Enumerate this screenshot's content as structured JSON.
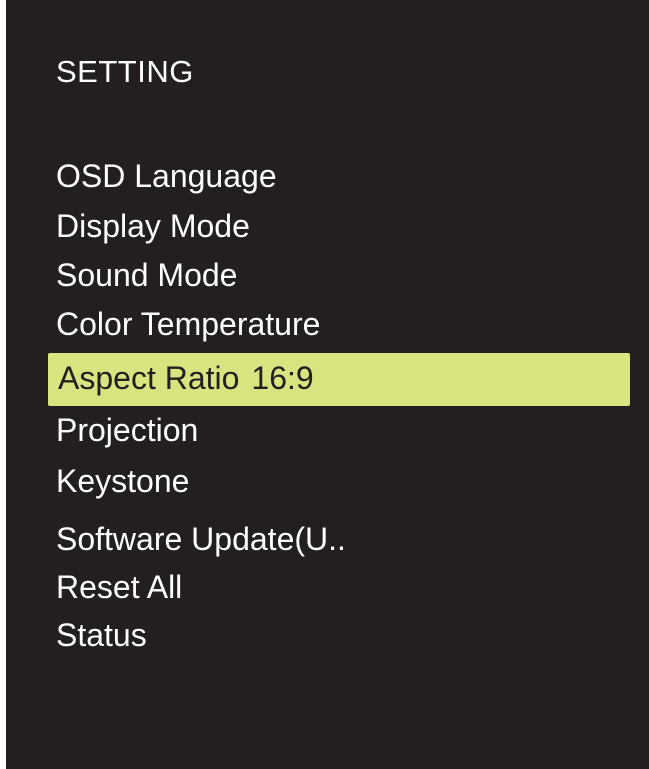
{
  "osd": {
    "title": "SETTING",
    "items": [
      {
        "label": "OSD Language"
      },
      {
        "label": "Display Mode"
      },
      {
        "label": "Sound Mode"
      },
      {
        "label": "Color Temperature"
      },
      {
        "label": "Aspect Ratio",
        "value": "16:9",
        "selected": true
      },
      {
        "label": "Projection"
      },
      {
        "label": "Keystone"
      },
      {
        "label": "Software Update(U.."
      },
      {
        "label": "Reset All"
      },
      {
        "label": "Status"
      }
    ]
  },
  "colors": {
    "background": "#231f20",
    "text": "#ffffff",
    "highlight": "#d9e37f",
    "highlight_text": "#231f20"
  }
}
